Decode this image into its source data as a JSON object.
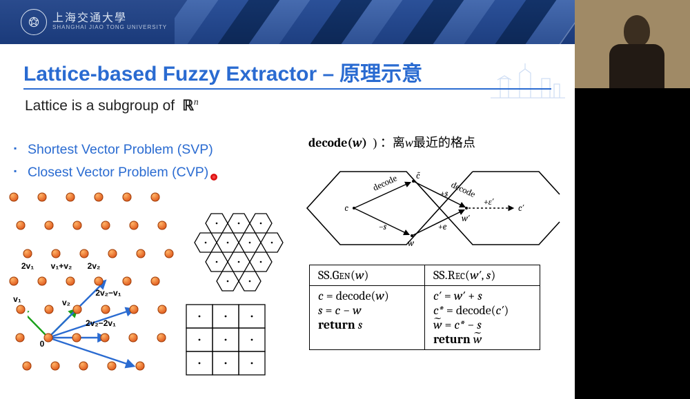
{
  "branding": {
    "uni_cn": "上海交通大學",
    "uni_en": "SHANGHAI JIAO TONG UNIVERSITY"
  },
  "title": {
    "en": "Lattice-based Fuzzy Extractor –",
    "zh": "原理示意"
  },
  "subhead": "Lattice is a subgroup of",
  "bullets": [
    "Shortest Vector Problem (SVP)",
    "Closest Vector Problem (CVP)"
  ],
  "lattice_labels": {
    "two_v1": "2v₁",
    "v1_plus_v2": "v₁+v₂",
    "two_v2": "2v₂",
    "v1": "v₁",
    "v2": "v₂",
    "two_v2_minus_v1": "2v₂−v₁",
    "two_v2_minus_2v1": "2v₂−2v₁",
    "origin": "0"
  },
  "decode_caption": {
    "pre": "decode(",
    "var": "w",
    "post": ") ：离",
    "post2": "最近的格点"
  },
  "diagram_labels": {
    "decode": "decode",
    "c": "c",
    "c_tilde": "c̃",
    "c_prime": "c′",
    "plus_s": "+s",
    "minus_s": "−s",
    "plus_e": "+e",
    "plus_ep": "+ε′",
    "w": "w",
    "w_prime": "w′"
  },
  "algorithm": {
    "gen_head_a": "SS.Gen(",
    "gen_head_b": "w",
    "gen_head_c": ")",
    "rec_head_a": "SS.Rec(",
    "rec_head_b": "w′",
    "rec_head_c": ", ",
    "rec_head_d": "s",
    "rec_head_e": ")",
    "g1_lhs": "c",
    "g1_eq": " = decode(",
    "g1_arg": "w",
    "g1_cl": ")",
    "g2_lhs": "s",
    "g2_eq": " = ",
    "g2_a": "c",
    "g2_m": " − ",
    "g2_b": "w",
    "g3_kw": "return",
    "g3_v": "s",
    "r1_lhs": "c′",
    "r1_eq": " = ",
    "r1_a": "w′",
    "r1_m": " + ",
    "r1_b": "s",
    "r2_lhs": "c*",
    "r2_eq": " = decode(",
    "r2_arg": "c′",
    "r2_cl": ")",
    "r3_lhs": "w̃",
    "r3_eq": " = ",
    "r3_a": "c*",
    "r3_m": " − ",
    "r3_b": "s",
    "r4_kw": "return",
    "r4_v": "w̃"
  }
}
